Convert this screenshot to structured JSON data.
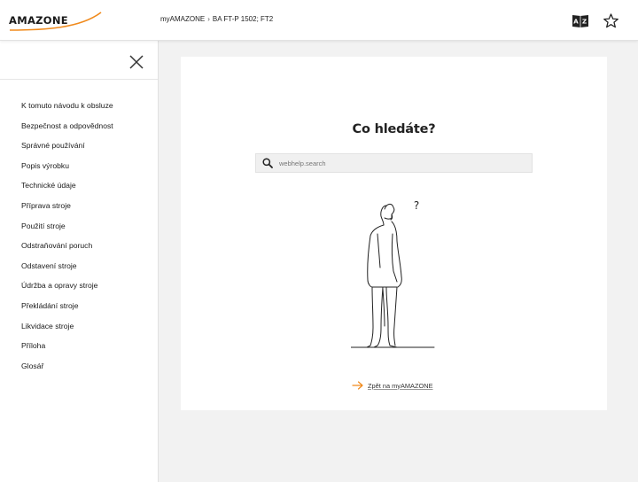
{
  "header": {
    "logo_text": "AMAZONE",
    "breadcrumb": [
      "myAMAZONE",
      "BA FT-P 1502; FT2"
    ],
    "breadcrumb_sep": "›",
    "icons": [
      "language-book-icon",
      "star-icon"
    ],
    "brand_color": "#f08a1c"
  },
  "sidebar": {
    "items": [
      {
        "label": "K tomuto návodu k obsluze"
      },
      {
        "label": "Bezpečnost a odpovědnost"
      },
      {
        "label": "Správné používání"
      },
      {
        "label": "Popis výrobku"
      },
      {
        "label": "Technické údaje"
      },
      {
        "label": "Příprava stroje"
      },
      {
        "label": "Použití stroje"
      },
      {
        "label": "Odstraňování poruch"
      },
      {
        "label": "Odstavení stroje"
      },
      {
        "label": "Údržba a opravy stroje"
      },
      {
        "label": "Překládání stroje"
      },
      {
        "label": "Likvidace stroje"
      },
      {
        "label": "Příloha"
      },
      {
        "label": "Glosář"
      }
    ]
  },
  "main": {
    "title": "Co hledáte?",
    "search_placeholder": "webhelp.search",
    "figure_mark": "?",
    "back_link": "Zpět na myAMAZONE"
  }
}
